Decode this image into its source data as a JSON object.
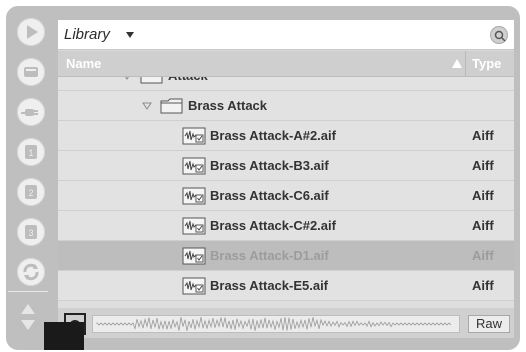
{
  "browser": {
    "title": "Library",
    "columns": {
      "name": "Name",
      "type": "Type"
    },
    "rows": [
      {
        "kind": "folder",
        "label": "Attack",
        "indent": 1,
        "type": "",
        "selected": false,
        "expanded": true
      },
      {
        "kind": "folder",
        "label": "Brass Attack",
        "indent": 2,
        "type": "",
        "selected": false,
        "expanded": true
      },
      {
        "kind": "file",
        "label": "Brass Attack-A#2.aif",
        "indent": 3,
        "type": "Aiff",
        "selected": false
      },
      {
        "kind": "file",
        "label": "Brass Attack-B3.aif",
        "indent": 3,
        "type": "Aiff",
        "selected": false
      },
      {
        "kind": "file",
        "label": "Brass Attack-C6.aif",
        "indent": 3,
        "type": "Aiff",
        "selected": false
      },
      {
        "kind": "file",
        "label": "Brass Attack-C#2.aif",
        "indent": 3,
        "type": "Aiff",
        "selected": false
      },
      {
        "kind": "file",
        "label": "Brass Attack-D1.aif",
        "indent": 3,
        "type": "Aiff",
        "selected": true
      },
      {
        "kind": "file",
        "label": "Brass Attack-E5.aif",
        "indent": 3,
        "type": "Aiff",
        "selected": false
      }
    ]
  },
  "sidebar": {
    "icons": [
      "play-icon",
      "hard-drive-icon",
      "plugin-icon",
      "folder-1-icon",
      "folder-2-icon",
      "folder-3-icon",
      "refresh-icon"
    ]
  },
  "preview": {
    "raw_label": "Raw"
  },
  "colors": {
    "selected_row": "#bdbdbd",
    "panel": "#bfbfbf"
  }
}
